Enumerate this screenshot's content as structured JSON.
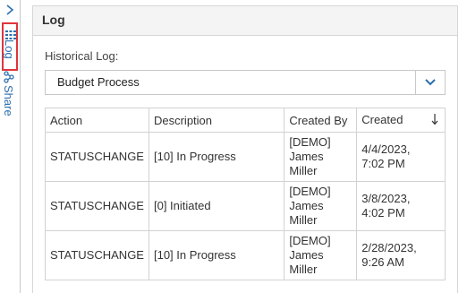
{
  "rail": {
    "log_label": "Log",
    "share_label": "Share"
  },
  "panel": {
    "title": "Log"
  },
  "historical_log": {
    "label": "Historical Log:",
    "selected_value": "Budget Process"
  },
  "table": {
    "columns": [
      "Action",
      "Description",
      "Created By",
      "Created"
    ],
    "rows": [
      {
        "action": "STATUSCHANGE",
        "description": "[10] In Progress",
        "created_by": [
          "[DEMO]",
          "James",
          "Miller"
        ],
        "created": [
          "4/4/2023,",
          "7:02 PM"
        ]
      },
      {
        "action": "STATUSCHANGE",
        "description": "[0] Initiated",
        "created_by": [
          "[DEMO]",
          "James",
          "Miller"
        ],
        "created": [
          "3/8/2023,",
          "4:02 PM"
        ]
      },
      {
        "action": "STATUSCHANGE",
        "description": "[10] In Progress",
        "created_by": [
          "[DEMO]",
          "James",
          "Miller"
        ],
        "created": [
          "2/28/2023,",
          "9:26 AM"
        ]
      }
    ]
  },
  "colors": {
    "accent": "#2d6fae",
    "highlight_border": "#e0343b"
  }
}
